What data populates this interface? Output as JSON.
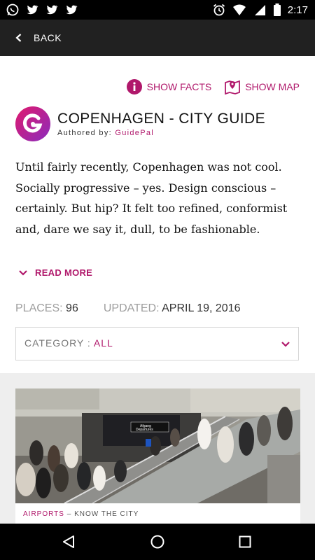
{
  "status_bar": {
    "time": "2:17",
    "left_icons": [
      "whatsapp-icon",
      "twitter-icon",
      "twitter-icon",
      "twitter-icon"
    ],
    "right_icons": [
      "alarm-icon",
      "wifi-icon",
      "cell-signal-icon",
      "battery-icon"
    ]
  },
  "app_bar": {
    "back_label": "BACK"
  },
  "actions": {
    "facts_label": "SHOW FACTS",
    "map_label": "SHOW MAP"
  },
  "guide": {
    "title": "COPENHAGEN - CITY GUIDE",
    "authored_prefix": "Authored by: ",
    "author": "GuidePal",
    "description": "Until fairly recently, Copenhagen was not cool. Socially progressive – yes. Design conscious – certainly. But hip? It felt too refined, conformist and, dare we say it, dull, to be fashionable.",
    "read_more": "READ MORE"
  },
  "meta": {
    "places_label": "PLACES:",
    "places_value": "96",
    "updated_label": "UPDATED:",
    "updated_value": "APRIL 19, 2016"
  },
  "category_select": {
    "label": "CATEGORY : ",
    "value": "ALL"
  },
  "card": {
    "image_sign_lines": [
      "Afgang",
      "Departures"
    ],
    "category": "AIRPORTS",
    "separator": " – ",
    "subtitle": "KNOW THE CITY"
  },
  "colors": {
    "accent": "#b0186b",
    "appbar": "#212121",
    "logo_start": "#e01a6d",
    "logo_end": "#8a2bbd"
  }
}
